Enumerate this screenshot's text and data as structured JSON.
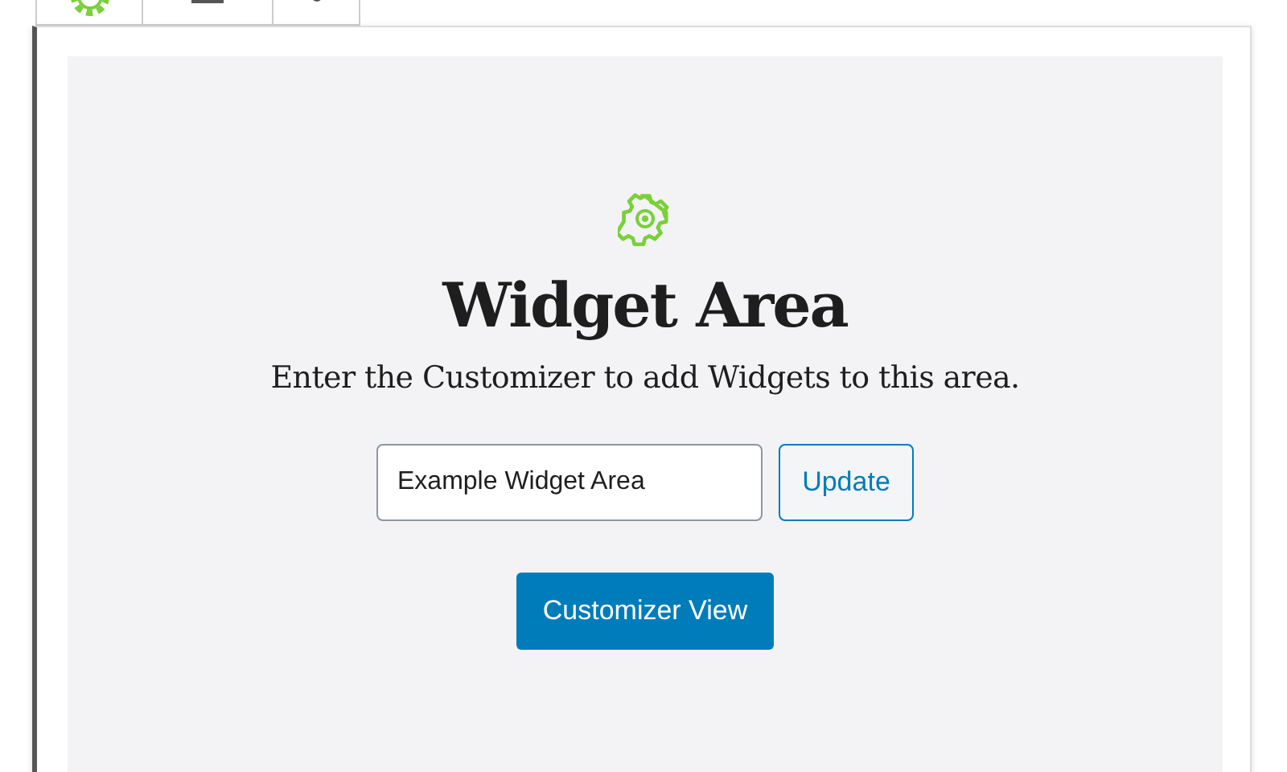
{
  "widget_area": {
    "title": "Widget Area",
    "description": "Enter the Customizer to add Widgets to this area.",
    "name_field": {
      "value": "Example Widget Area"
    },
    "update_button": "Update",
    "customizer_button": "Customizer View"
  }
}
